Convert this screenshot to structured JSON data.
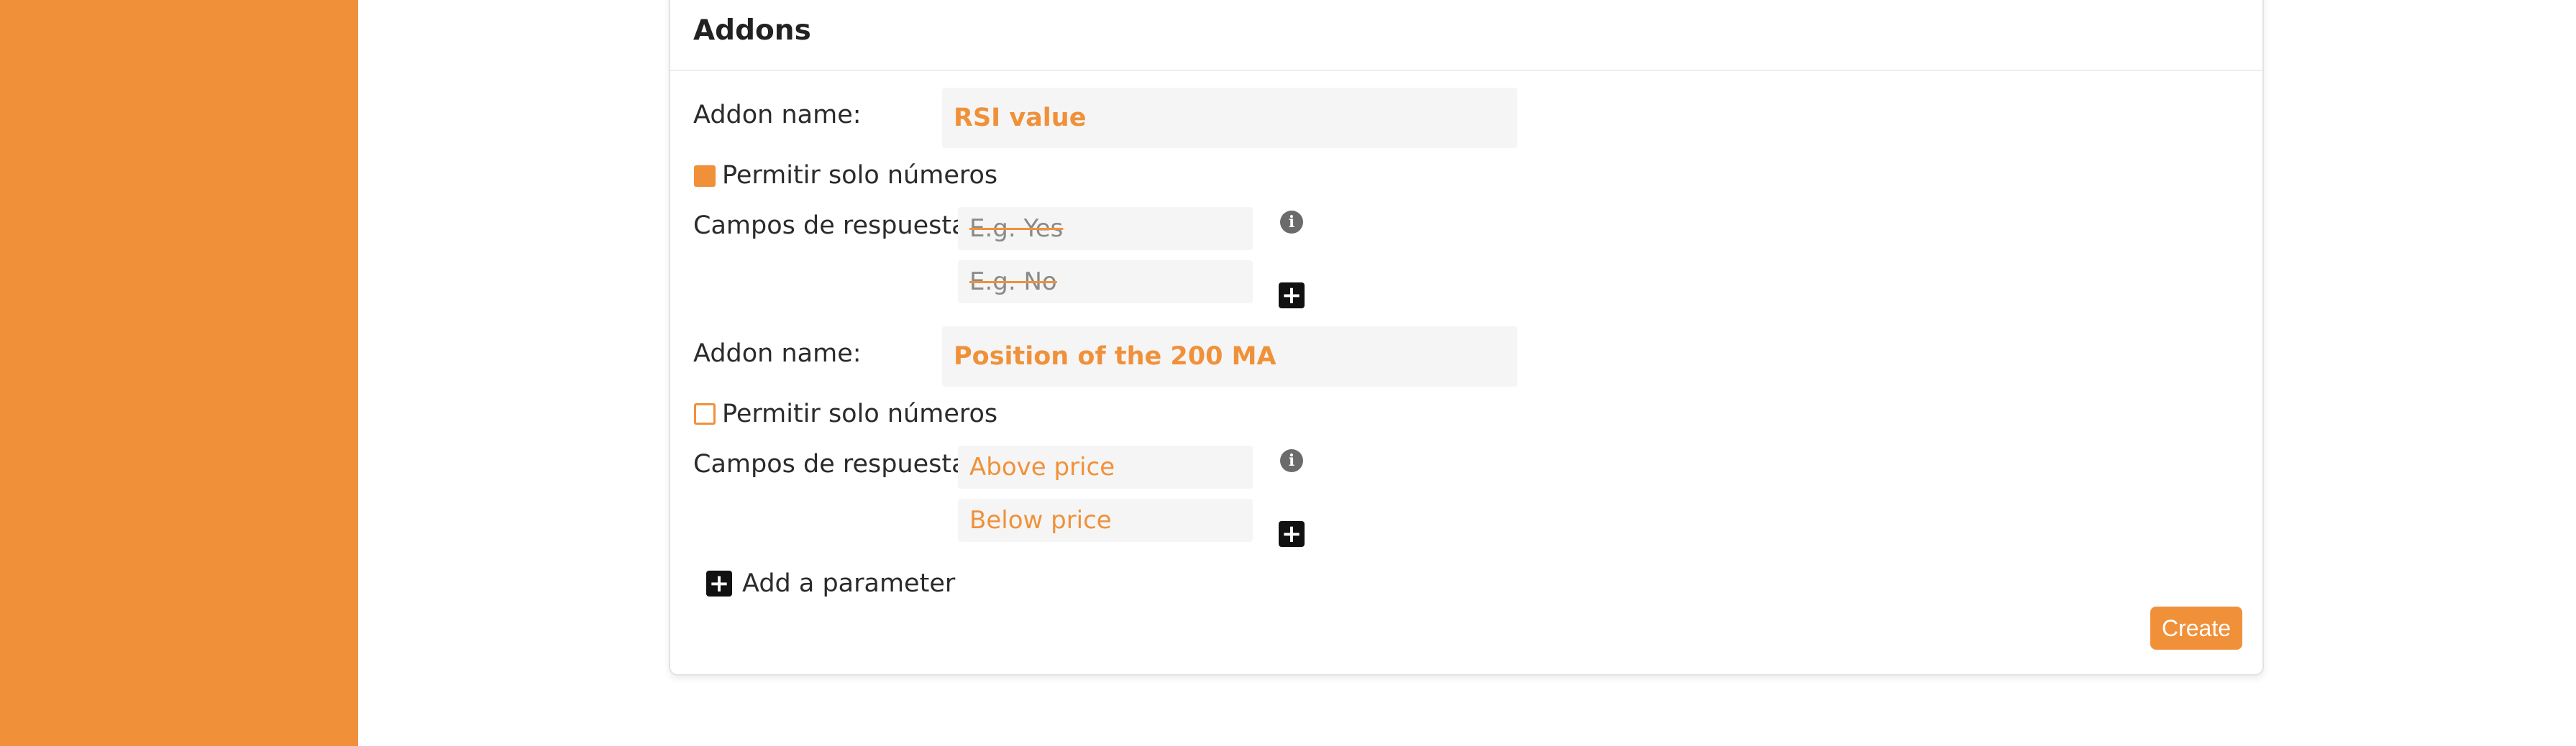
{
  "card": {
    "title": "Addons"
  },
  "addons": [
    {
      "name_label": "Addon name:",
      "name_value": "RSI value",
      "numbers_only_label": "Permitir solo números",
      "numbers_only_checked": true,
      "answers_label": "Campos de respuesta:",
      "answers": [
        {
          "text": "E.g. Yes",
          "is_placeholder": true
        },
        {
          "text": "E.g. No",
          "is_placeholder": true
        }
      ]
    },
    {
      "name_label": "Addon name:",
      "name_value": "Position of the 200 MA",
      "numbers_only_label": "Permitir solo números",
      "numbers_only_checked": false,
      "answers_label": "Campos de respuesta:",
      "answers": [
        {
          "text": "Above price",
          "is_placeholder": false
        },
        {
          "text": "Below price",
          "is_placeholder": false
        }
      ]
    }
  ],
  "add_parameter_label": "Add a parameter",
  "create_label": "Create",
  "icons": {
    "info": "info-icon",
    "plus": "plus-square-icon"
  },
  "colors": {
    "accent": "#f0913a",
    "input_bg": "#f5f5f5"
  }
}
